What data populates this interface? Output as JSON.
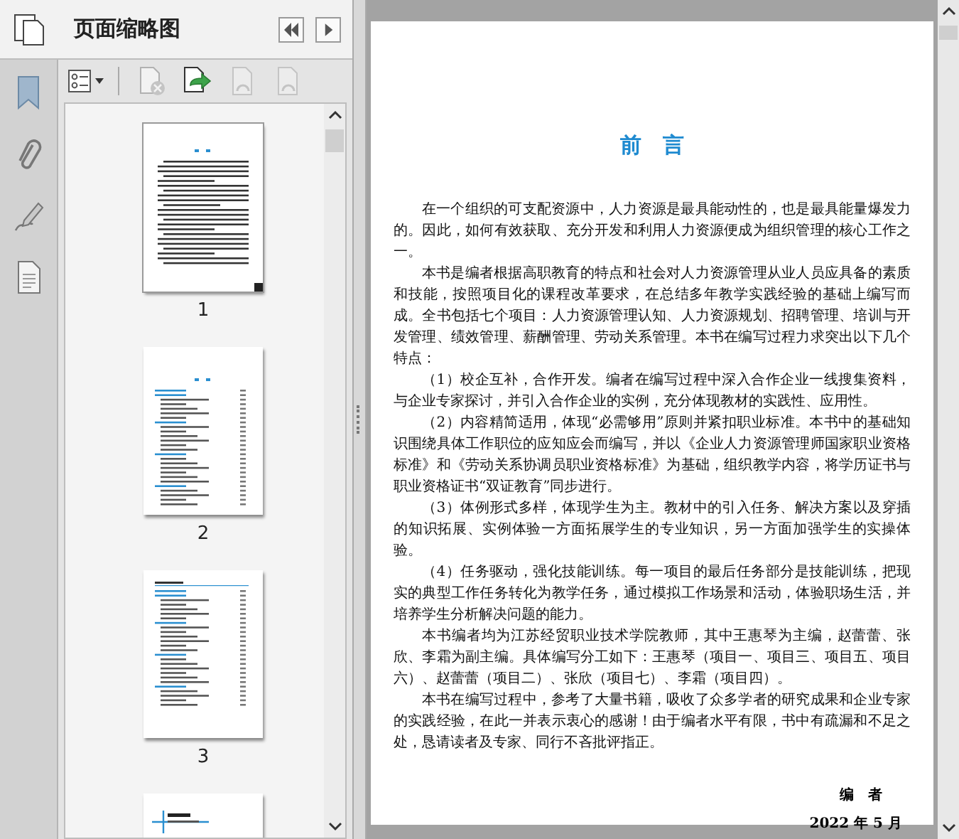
{
  "sidebar": {
    "title": "页面缩略图",
    "tools": [
      {
        "kind": "options",
        "disabled": false
      },
      {
        "kind": "delete",
        "disabled": true
      },
      {
        "kind": "insert",
        "disabled": false
      },
      {
        "kind": "undo",
        "disabled": true
      },
      {
        "kind": "redo",
        "disabled": true
      }
    ],
    "thumbnails": [
      {
        "kind": "text",
        "label": "1",
        "selected": true
      },
      {
        "kind": "toc",
        "label": "2",
        "selected": false
      },
      {
        "kind": "toc2",
        "label": "3",
        "selected": false
      },
      {
        "kind": "chapter",
        "selected": false
      }
    ]
  },
  "document": {
    "title": "前　言",
    "paragraphs": [
      "在一个组织的可支配资源中，人力资源是最具能动性的，也是最具能量爆发力的。因此，如何有效获取、充分开发和利用人力资源便成为组织管理的核心工作之一。",
      "本书是编者根据高职教育的特点和社会对人力资源管理从业人员应具备的素质和技能，按照项目化的课程改革要求，在总结多年教学实践经验的基础上编写而成。全书包括七个项目：人力资源管理认知、人力资源规划、招聘管理、培训与开发管理、绩效管理、薪酬管理、劳动关系管理。本书在编写过程力求突出以下几个特点：",
      "（1）校企互补，合作开发。编者在编写过程中深入合作企业一线搜集资料，与企业专家探讨，并引入合作企业的实例，充分体现教材的实践性、应用性。",
      "（2）内容精简适用，体现“必需够用”原则并紧扣职业标准。本书中的基础知识围绕具体工作职位的应知应会而编写，并以《企业人力资源管理师国家职业资格标准》和《劳动关系协调员职业资格标准》为基础，组织教学内容，将学历证书与职业资格证书“双证教育”同步进行。",
      "（3）体例形式多样，体现学生为主。教材中的引入任务、解决方案以及穿插的知识拓展、实例体验一方面拓展学生的专业知识，另一方面加强学生的实操体验。",
      "（4）任务驱动，强化技能训练。每一项目的最后任务部分是技能训练，把现实的典型工作任务转化为教学任务，通过模拟工作场景和活动，体验职场生活，并培养学生分析解决问题的能力。",
      "本书编者均为江苏经贸职业技术学院教师，其中王惠琴为主编，赵蕾蕾、张欣、李霜为副主编。具体编写分工如下：王惠琴（项目一、项目三、项目五、项目六）、赵蕾蕾（项目二）、张欣（项目七）、李霜（项目四）。",
      "本书在编写过程中，参考了大量书籍，吸收了众多学者的研究成果和企业专家的实践经验，在此一并表示衷心的感谢！由于编者水平有限，书中有疏漏和不足之处，恳请读者及专家、同行不吝批评指正。"
    ],
    "signature": "编　者",
    "date": "2022 年 5 月"
  }
}
